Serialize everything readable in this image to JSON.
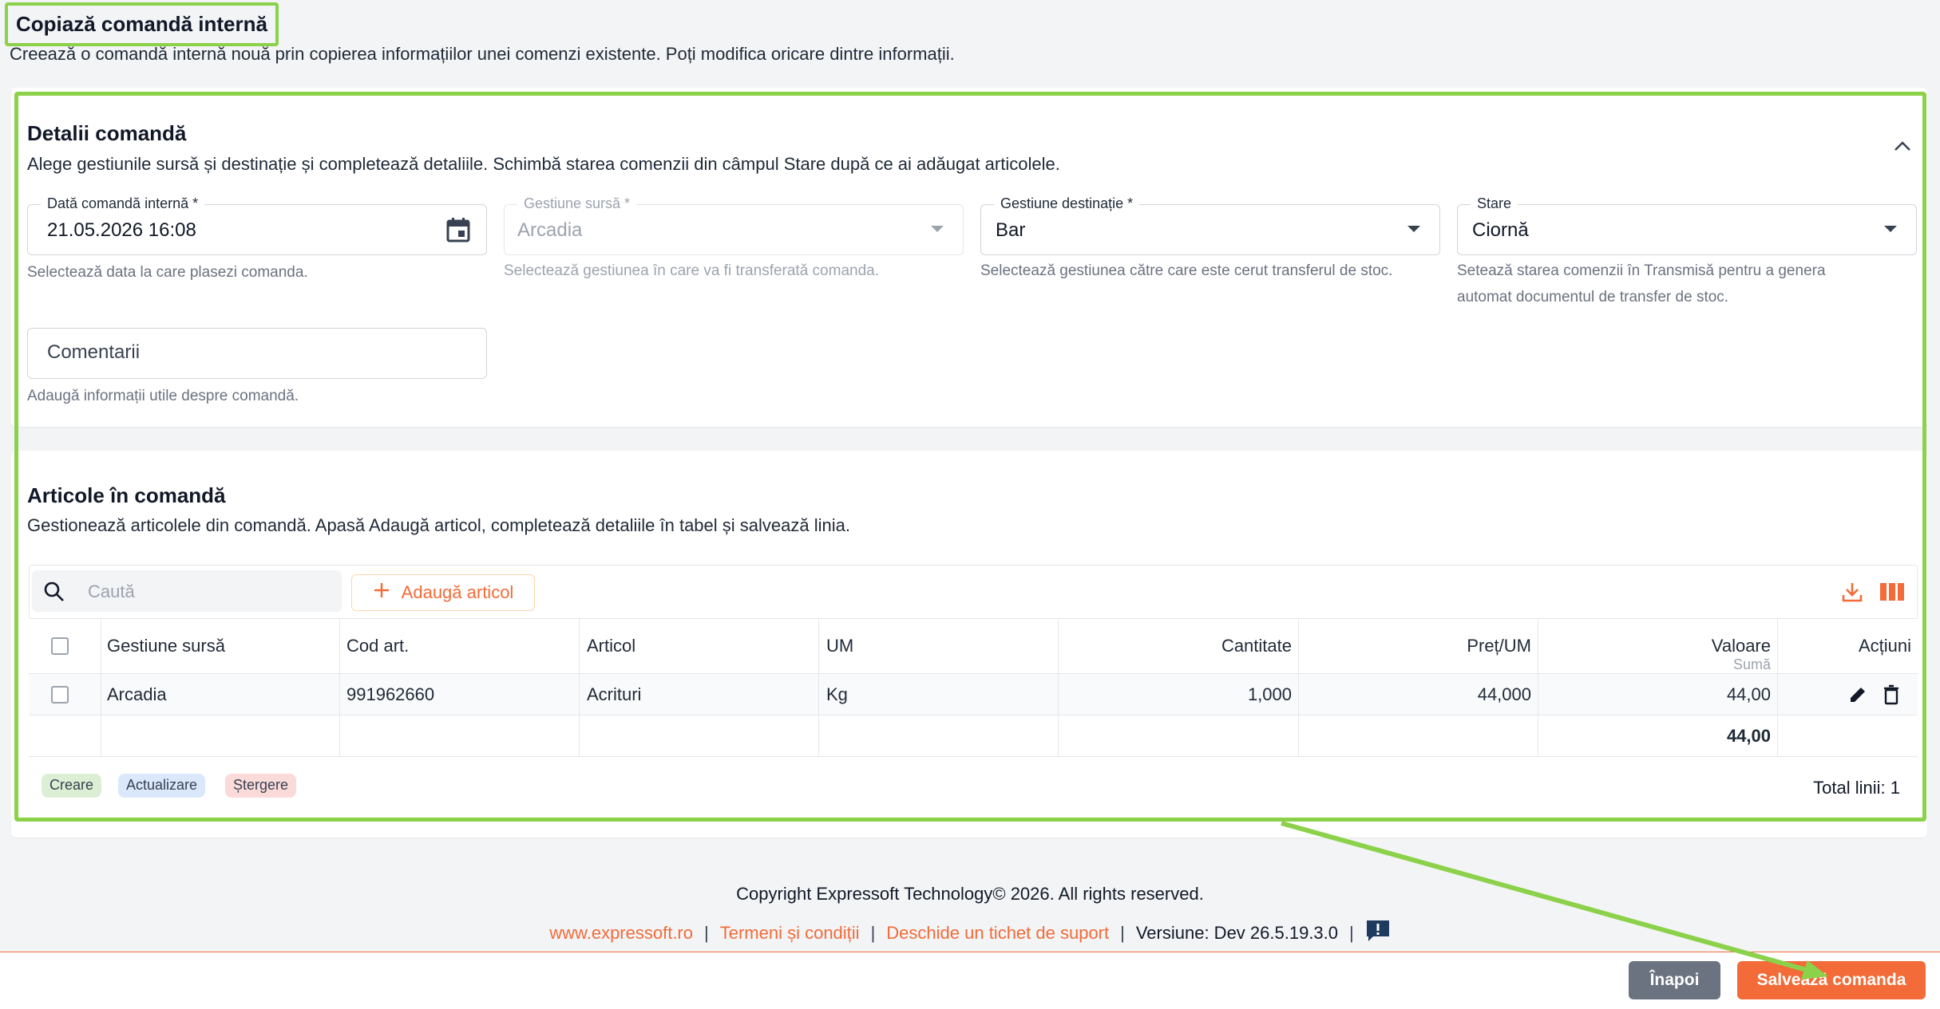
{
  "page": {
    "title": "Copiază comandă internă",
    "subtitle": "Creează o comandă internă nouă prin copierea informațiilor unei comenzi existente. Poți modifica oricare dintre informații."
  },
  "details": {
    "title": "Detalii comandă",
    "subtitle": "Alege gestiunile sursă și destinație și completează detaliile. Schimbă starea comenzii din câmpul Stare după ce ai adăugat articolele.",
    "date": {
      "label": "Dată comandă internă *",
      "value": "21.05.2026 16:08",
      "help": "Selectează data la care plasezi comanda."
    },
    "source": {
      "label": "Gestiune sursă *",
      "value": "Arcadia",
      "help": "Selectează gestiunea în care va fi transferată comanda."
    },
    "destination": {
      "label": "Gestiune destinație *",
      "value": "Bar",
      "help": "Selectează gestiunea către care este cerut transferul de stoc."
    },
    "status": {
      "label": "Stare",
      "value": "Ciornă",
      "help_line1": "Setează starea comenzii în Transmisă pentru a genera",
      "help_line2": "automat documentul de transfer de stoc."
    },
    "comments": {
      "placeholder": "Comentarii",
      "help": "Adaugă informații utile despre comandă."
    }
  },
  "articles": {
    "title": "Articole în comandă",
    "subtitle": "Gestionează articolele din comandă. Apasă Adaugă articol, completează detaliile în tabel și salvează linia.",
    "search_placeholder": "Caută",
    "add_button": "Adaugă articol",
    "columns": {
      "source": "Gestiune sursă",
      "code": "Cod art.",
      "article": "Articol",
      "um": "UM",
      "quantity": "Cantitate",
      "price": "Preț/UM",
      "value": "Valoare",
      "value_sub": "Sumă",
      "actions": "Acțiuni"
    },
    "rows": [
      {
        "source": "Arcadia",
        "code": "991962660",
        "article": "Acrituri",
        "um": "Kg",
        "quantity": "1,000",
        "price": "44,000",
        "value": "44,00"
      }
    ],
    "total_value": "44,00",
    "legend": [
      "Creare",
      "Actualizare",
      "Ștergere"
    ],
    "total_lines": "Total linii: 1"
  },
  "footer": {
    "copyright": "Copyright Expressoft Technology© 2026. All rights reserved.",
    "link_site": "www.expressoft.ro",
    "link_terms": "Termeni și condiții",
    "link_ticket": "Deschide un tichet de suport",
    "version": "Versiune: Dev 26.5.19.3.0"
  },
  "actions": {
    "back": "Înapoi",
    "save": "Salvează comanda"
  },
  "colors": {
    "accent": "#f26b38",
    "highlight": "#8cd14a",
    "legend_create": "#dcefd4",
    "legend_update": "#dbe8fb",
    "legend_delete": "#fbdada"
  }
}
